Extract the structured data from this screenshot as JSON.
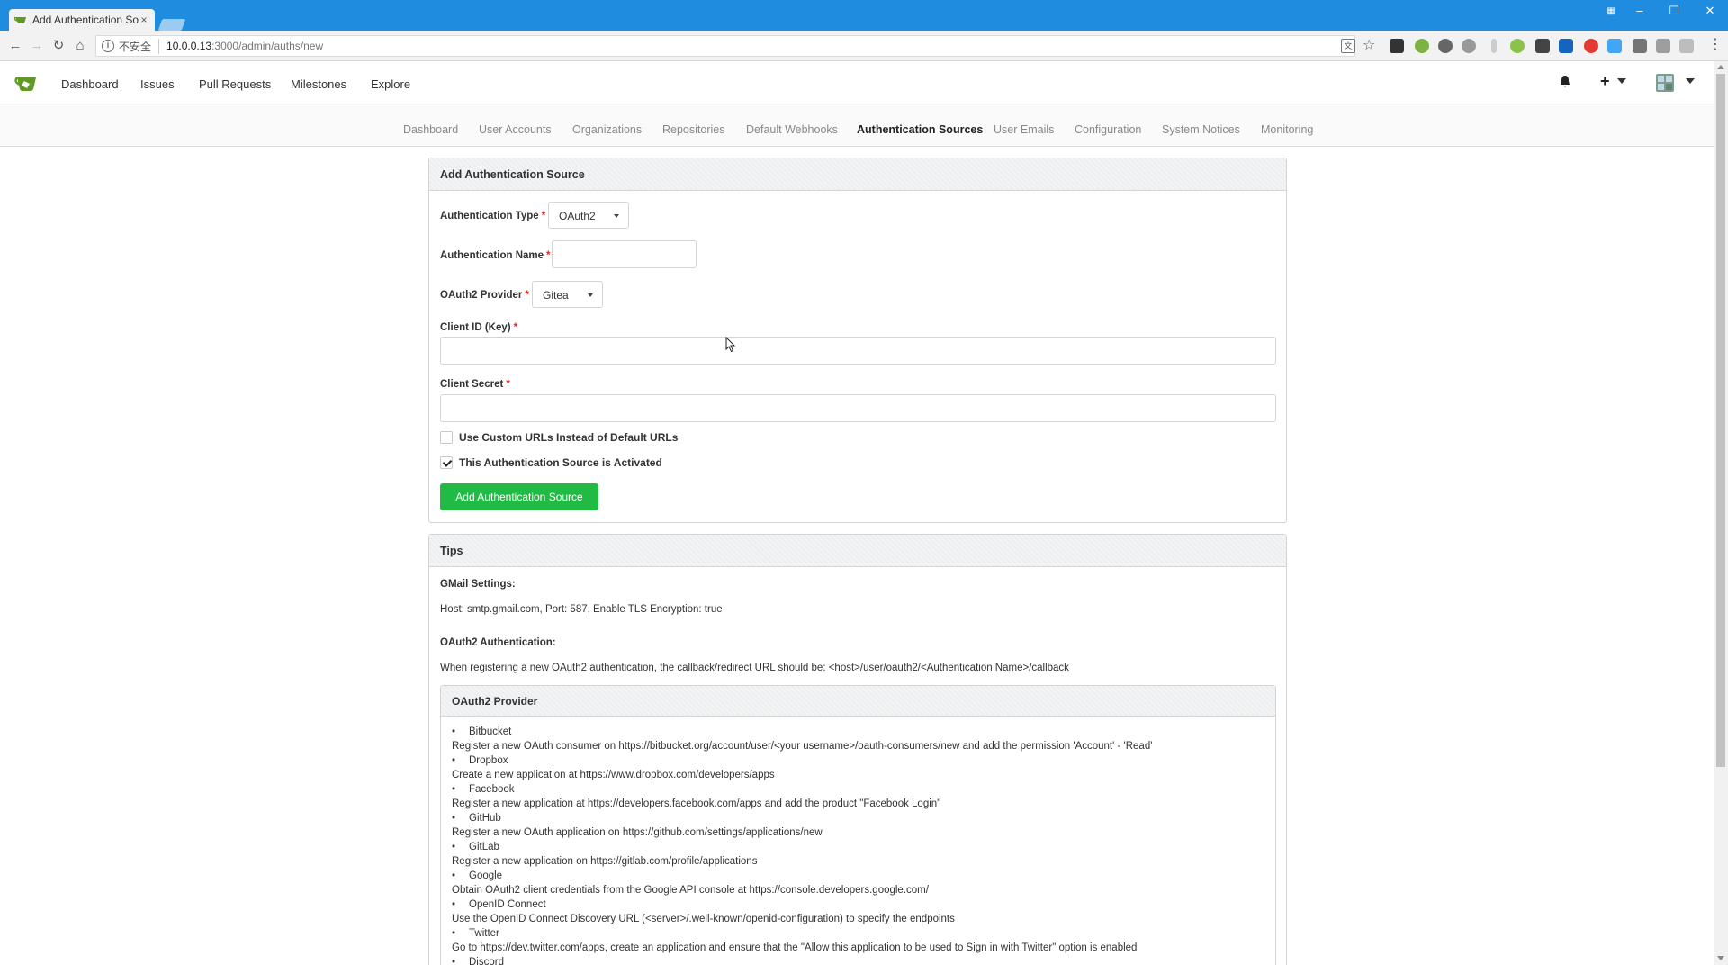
{
  "browser": {
    "tab_title": "Add Authentication So",
    "tab_close": "×",
    "insecure_label": "不安全",
    "url_host": "10.0.0.13",
    "url_path": ":3000/admin/auths/new",
    "icons": [
      "back-icon",
      "forward-icon",
      "reload-icon",
      "home-icon",
      "info-icon",
      "translate-icon",
      "star-icon",
      "menu-icon"
    ]
  },
  "navbar": {
    "links": [
      "Dashboard",
      "Issues",
      "Pull Requests",
      "Milestones",
      "Explore"
    ],
    "plus": "+",
    "accent": "#609926"
  },
  "admin_menu": {
    "items": [
      "Dashboard",
      "User Accounts",
      "Organizations",
      "Repositories",
      "Default Webhooks",
      "Authentication Sources",
      "User Emails",
      "Configuration",
      "System Notices",
      "Monitoring"
    ],
    "active": "Authentication Sources"
  },
  "form": {
    "header": "Add Authentication Source",
    "auth_type_label": "Authentication Type",
    "auth_type_value": "OAuth2",
    "auth_name_label": "Authentication Name",
    "auth_name_value": "",
    "provider_label": "OAuth2 Provider",
    "provider_value": "Gitea",
    "client_id_label": "Client ID (Key)",
    "client_id_value": "",
    "client_secret_label": "Client Secret",
    "client_secret_value": "",
    "required_mark": "*",
    "custom_urls_label": "Use Custom URLs Instead of Default URLs",
    "custom_urls_checked": false,
    "activated_label": "This Authentication Source is Activated",
    "activated_checked": true,
    "submit_label": "Add Authentication Source",
    "submit_color": "#21ba45"
  },
  "tips": {
    "header": "Tips",
    "gmail_title": "GMail Settings:",
    "gmail_text": "Host: smtp.gmail.com, Port: 587, Enable TLS Encryption: true",
    "oauth2_title": "OAuth2 Authentication:",
    "oauth2_text": "When registering a new OAuth2 authentication, the callback/redirect URL should be: <host>/user/oauth2/<Authentication Name>/callback",
    "provider_header": "OAuth2 Provider",
    "providers": [
      {
        "name": "Bitbucket",
        "desc": "Register a new OAuth consumer on https://bitbucket.org/account/user/<your username>/oauth-consumers/new and add the permission 'Account' - 'Read'"
      },
      {
        "name": "Dropbox",
        "desc": "Create a new application at https://www.dropbox.com/developers/apps"
      },
      {
        "name": "Facebook",
        "desc": "Register a new application at https://developers.facebook.com/apps and add the product \"Facebook Login\""
      },
      {
        "name": "GitHub",
        "desc": "Register a new OAuth application on https://github.com/settings/applications/new"
      },
      {
        "name": "GitLab",
        "desc": "Register a new application on https://gitlab.com/profile/applications"
      },
      {
        "name": "Google",
        "desc": "Obtain OAuth2 client credentials from the Google API console at https://console.developers.google.com/"
      },
      {
        "name": "OpenID Connect",
        "desc": "Use the OpenID Connect Discovery URL (<server>/.well-known/openid-configuration) to specify the endpoints"
      },
      {
        "name": "Twitter",
        "desc": "Go to https://dev.twitter.com/apps, create an application and ensure that the \"Allow this application to be used to Sign in with Twitter\" option is enabled"
      },
      {
        "name": "Discord",
        "desc": ""
      }
    ]
  }
}
